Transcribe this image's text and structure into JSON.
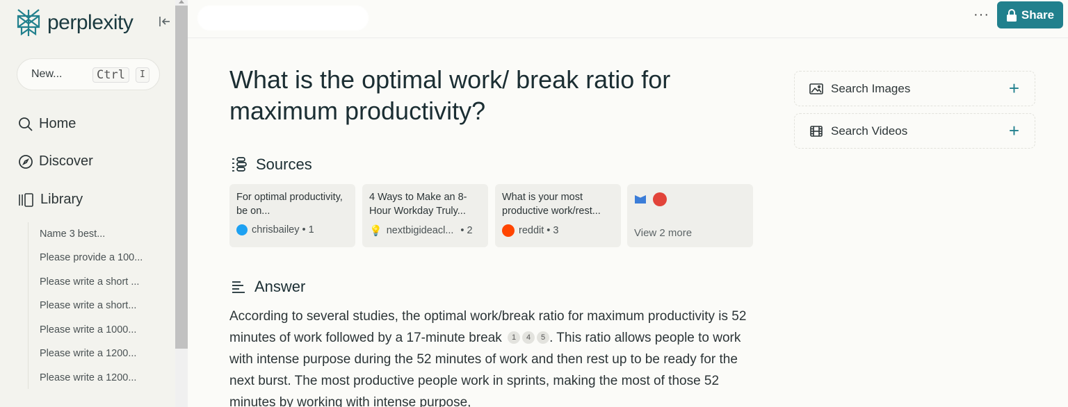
{
  "brand": {
    "name": "perplexity",
    "accent": "#21808d"
  },
  "sidebar": {
    "new_label": "New...",
    "shortcut_keys": [
      "Ctrl",
      "I"
    ],
    "nav": [
      {
        "label": "Home",
        "icon": "search-icon"
      },
      {
        "label": "Discover",
        "icon": "compass-icon"
      },
      {
        "label": "Library",
        "icon": "library-icon"
      }
    ],
    "library_items": [
      "Name 3 best...",
      "Please provide a 100...",
      "Please write a short ...",
      "Please write a short...",
      "Please write a 1000...",
      "Please write a 1200...",
      "Please write a 1200..."
    ]
  },
  "topbar": {
    "menu_label": "···",
    "share_label": "Share"
  },
  "thread": {
    "title": "What is the optimal work/ break ratio for maximum productivity?",
    "sources_heading": "Sources",
    "sources": [
      {
        "title": "For optimal productivity, be on...",
        "site": "chrisbailey",
        "index": "1",
        "color": "#1da1f2"
      },
      {
        "title": "4 Ways to Make an 8-Hour Workday Truly...",
        "site": "nextbigideacl...",
        "index": "2",
        "color": "#f5c33b"
      },
      {
        "title": "What is your most productive work/rest...",
        "site": "reddit",
        "index": "3",
        "color": "#ff4500"
      }
    ],
    "more_sources": {
      "label": "View 2 more",
      "colors": [
        "#3b7dd8",
        "#e2443a"
      ]
    },
    "answer_heading": "Answer",
    "answer": {
      "part1": "According to several studies, the optimal work/break ratio for maximum productivity is 52 minutes of work followed by a 17-minute break",
      "citations": [
        "1",
        "4",
        "5"
      ],
      "part2": ". This ratio allows people to work with intense purpose during the 52 minutes of work and then rest up to be ready for the next burst. The most productive people work in sprints, making the most of those 52 minutes by working with intense purpose,"
    }
  },
  "right_panel": {
    "search_images": "Search Images",
    "search_videos": "Search Videos"
  }
}
